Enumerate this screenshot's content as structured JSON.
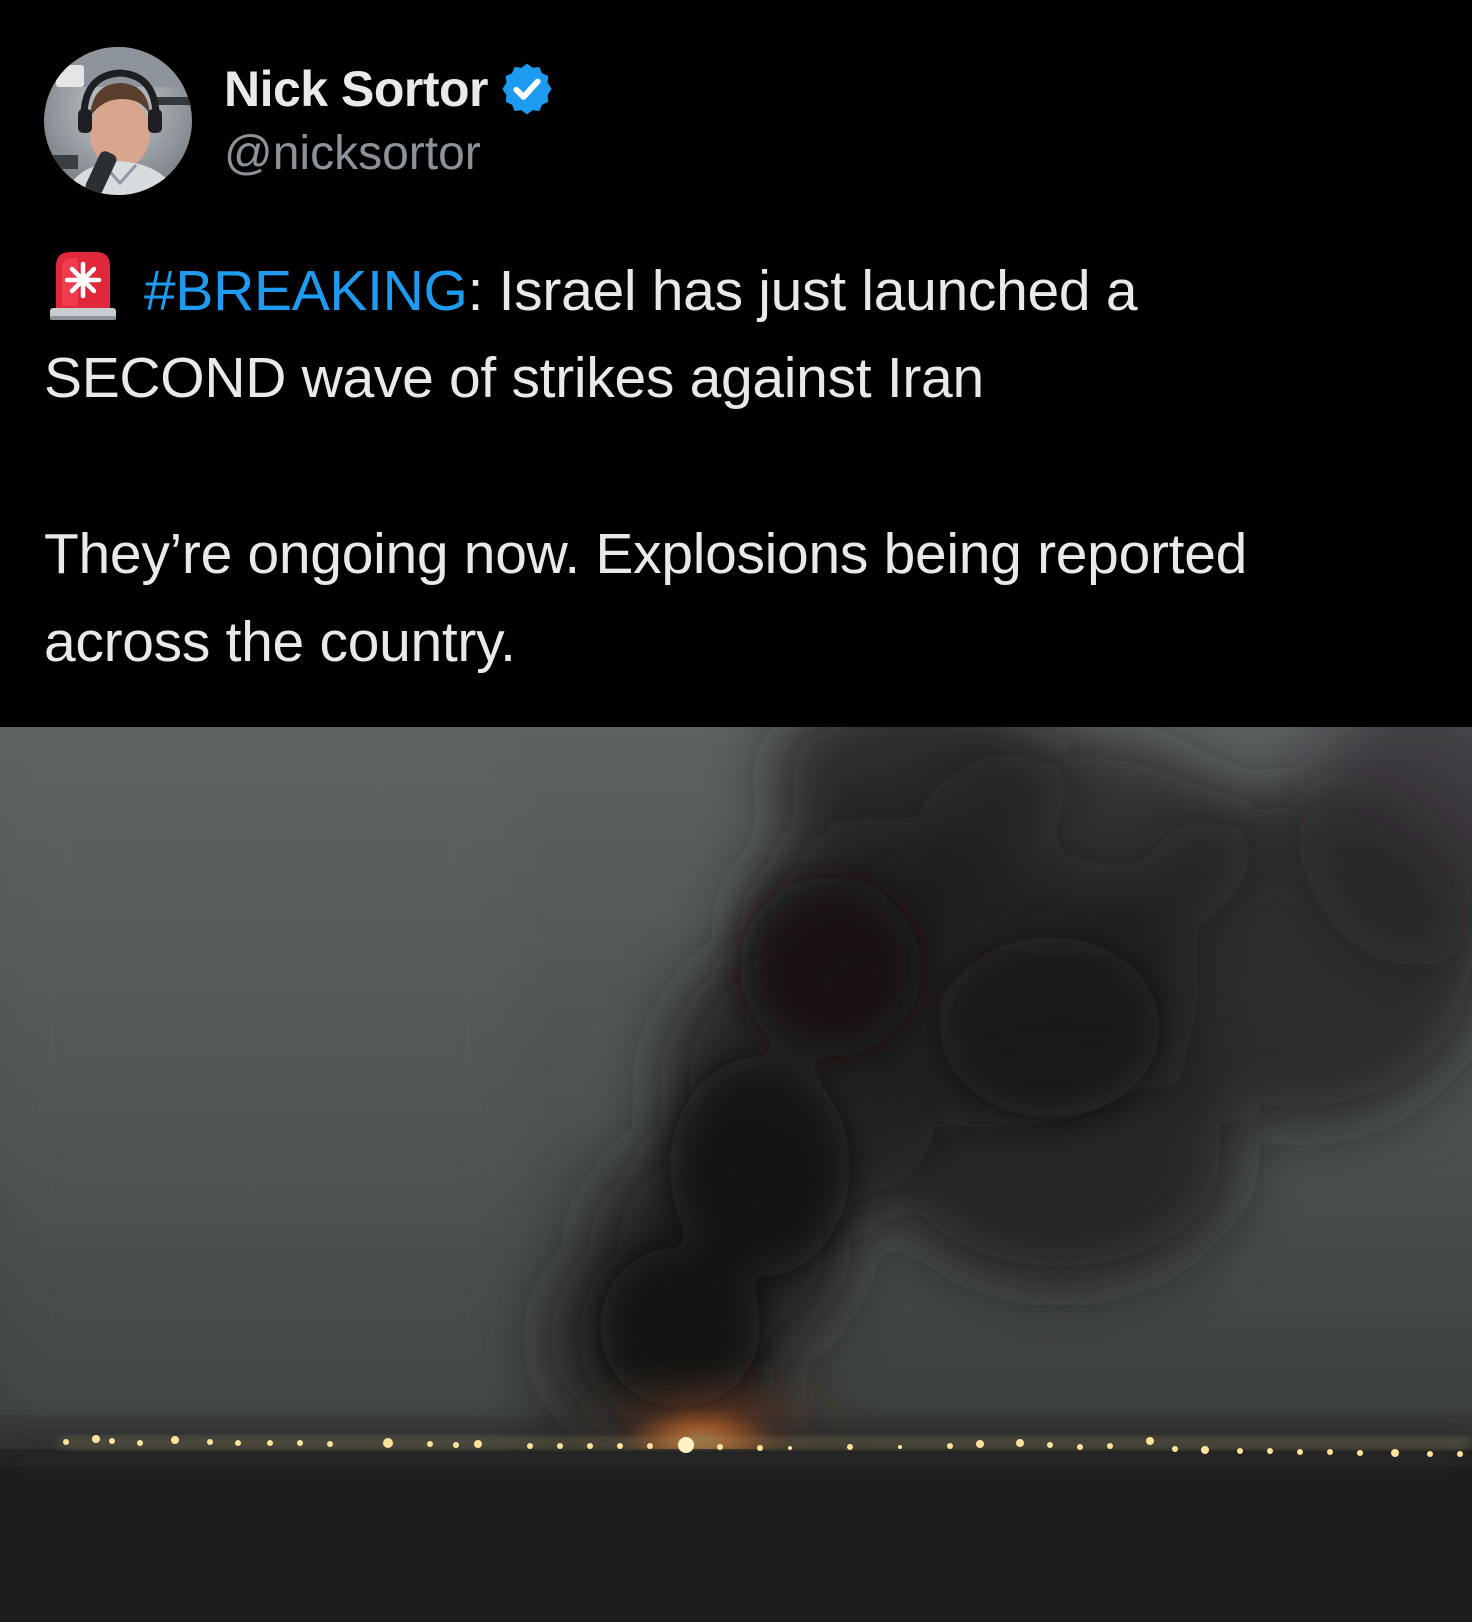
{
  "author": {
    "display_name": "Nick Sortor",
    "handle": "@nicksortor",
    "avatar_icon": "profile-photo",
    "verified_icon": "verified-badge-icon",
    "verified_color": "#1d9bf0"
  },
  "post": {
    "emoji_icon": "police-car-light-icon",
    "hashtag": "#BREAKING",
    "line1_rest": ": Israel has just launched a",
    "line2": "SECOND wave of strikes against Iran",
    "line3": "They’re ongoing now. Explosions being reported",
    "line4": "across the country."
  },
  "media": {
    "icon": "photo-smoke-plume"
  },
  "colors": {
    "background": "#000000",
    "text": "#e7e9ea",
    "secondary_text": "#8b9299",
    "link": "#1d9bf0"
  }
}
